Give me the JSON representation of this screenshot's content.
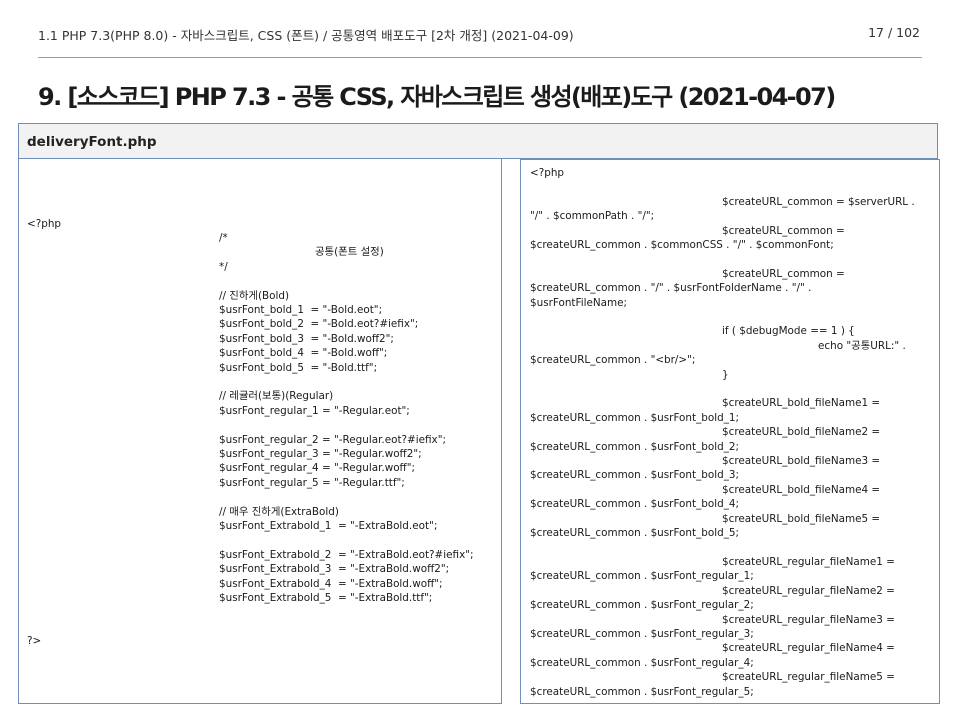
{
  "header": {
    "breadcrumb": "1.1 PHP 7.3(PHP 8.0) - 자바스크립트, CSS (폰트) / 공통영역 배포도구 [2차 개정] (2021-04-09)",
    "page_number": "17 / 102"
  },
  "title": "9. [소스코드] PHP 7.3 - 공통 CSS, 자바스크립트 생성(배포)도구 (2021-04-07)",
  "file": {
    "name": "deliveryFont.php"
  },
  "left_code": [
    "",
    "",
    "",
    "",
    "<?php",
    "\t/*",
    "\t\t\t\t공통(폰트 설정)",
    "\t*/",
    "",
    "\t// 진하게(Bold)",
    "\t$usrFont_bold_1  = \"-Bold.eot\";",
    "\t$usrFont_bold_2  = \"-Bold.eot?#iefix\";",
    "\t$usrFont_bold_3  = \"-Bold.woff2\";",
    "\t$usrFont_bold_4  = \"-Bold.woff\";",
    "\t$usrFont_bold_5  = \"-Bold.ttf\";",
    "",
    "\t// 레귤러(보통)(Regular)",
    "\t$usrFont_regular_1 = \"-Regular.eot\";",
    "",
    "\t$usrFont_regular_2 = \"-Regular.eot?#iefix\";",
    "\t$usrFont_regular_3 = \"-Regular.woff2\";",
    "\t$usrFont_regular_4 = \"-Regular.woff\";",
    "\t$usrFont_regular_5 = \"-Regular.ttf\";",
    "",
    "\t// 매우 진하게(ExtraBold)",
    "\t$usrFont_Extrabold_1  = \"-ExtraBold.eot\";",
    "",
    "\t$usrFont_Extrabold_2  = \"-ExtraBold.eot?#iefix\";",
    "\t$usrFont_Extrabold_3  = \"-ExtraBold.woff2\";",
    "\t$usrFont_Extrabold_4  = \"-ExtraBold.woff\";",
    "\t$usrFont_Extrabold_5  = \"-ExtraBold.ttf\";",
    "",
    "",
    "?>"
  ],
  "right_code": [
    "<?php",
    "",
    "\t$createURL_common = $serverURL .",
    "\"/\" . $commonPath . \"/\";",
    "\t$createURL_common =",
    "$createURL_common . $commonCSS . \"/\" . $commonFont;",
    "",
    "\t$createURL_common =",
    "$createURL_common . \"/\" . $usrFontFolderName . \"/\" .",
    "$usrFontFileName;",
    "",
    "\tif ( $debugMode == 1 ) {",
    "\t\t\techo \"공통URL:\" .",
    "$createURL_common . \"<br/>\";",
    "\t}",
    "",
    "\t$createURL_bold_fileName1 =",
    "$createURL_common . $usrFont_bold_1;",
    "\t$createURL_bold_fileName2 =",
    "$createURL_common . $usrFont_bold_2;",
    "\t$createURL_bold_fileName3 =",
    "$createURL_common . $usrFont_bold_3;",
    "\t$createURL_bold_fileName4 =",
    "$createURL_common . $usrFont_bold_4;",
    "\t$createURL_bold_fileName5 =",
    "$createURL_common . $usrFont_bold_5;",
    "",
    "\t$createURL_regular_fileName1 =",
    "$createURL_common . $usrFont_regular_1;",
    "\t$createURL_regular_fileName2 =",
    "$createURL_common . $usrFont_regular_2;",
    "\t$createURL_regular_fileName3 =",
    "$createURL_common . $usrFont_regular_3;",
    "\t$createURL_regular_fileName4 =",
    "$createURL_common . $usrFont_regular_4;",
    "\t$createURL_regular_fileName5 =",
    "$createURL_common . $usrFont_regular_5;"
  ]
}
